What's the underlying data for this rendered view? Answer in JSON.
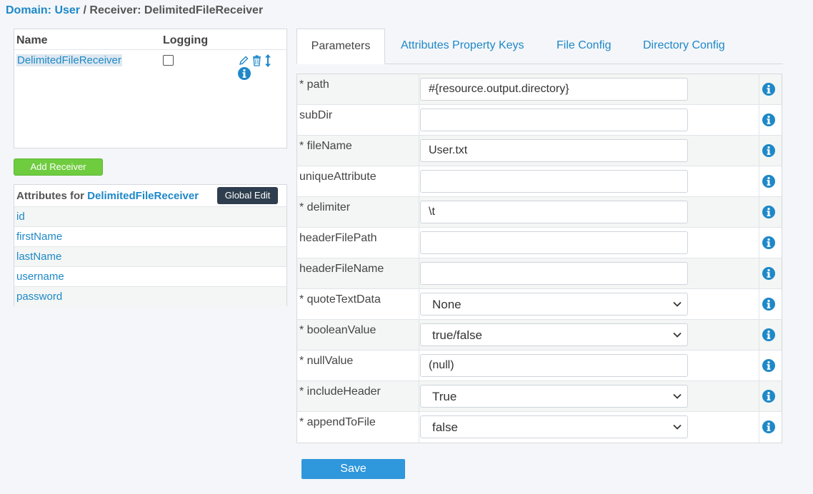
{
  "breadcrumb": {
    "domain_label": "Domain:",
    "domain_value": "User",
    "separator": "/",
    "receiver_text": "Receiver: DelimitedFileReceiver"
  },
  "receivers": {
    "col_name": "Name",
    "col_logging": "Logging",
    "rows": [
      {
        "name": "DelimitedFileReceiver",
        "logging": false
      }
    ],
    "icons": [
      "edit-icon",
      "trash-icon",
      "sort-icon",
      "info-icon"
    ]
  },
  "add_receiver_label": "Add Receiver",
  "attributes": {
    "title_prefix": "Attributes for",
    "title_name": "DelimitedFileReceiver",
    "global_edit_label": "Global Edit",
    "items": [
      "id",
      "firstName",
      "lastName",
      "username",
      "password"
    ]
  },
  "tabs": [
    {
      "label": "Parameters",
      "active": true
    },
    {
      "label": "Attributes Property Keys",
      "active": false
    },
    {
      "label": "File Config",
      "active": false
    },
    {
      "label": "Directory Config",
      "active": false
    }
  ],
  "params": [
    {
      "label": "* path",
      "type": "input",
      "value": "#{resource.output.directory}"
    },
    {
      "label": "subDir",
      "type": "input",
      "value": ""
    },
    {
      "label": "* fileName",
      "type": "input",
      "value": "User.txt"
    },
    {
      "label": "uniqueAttribute",
      "type": "input",
      "value": ""
    },
    {
      "label": "* delimiter",
      "type": "input",
      "value": "\\t"
    },
    {
      "label": "headerFilePath",
      "type": "input",
      "value": ""
    },
    {
      "label": "headerFileName",
      "type": "input",
      "value": ""
    },
    {
      "label": "* quoteTextData",
      "type": "select",
      "value": "None"
    },
    {
      "label": "* booleanValue",
      "type": "select",
      "value": "true/false"
    },
    {
      "label": "* nullValue",
      "type": "input",
      "value": "(null)"
    },
    {
      "label": "* includeHeader",
      "type": "select",
      "value": "True"
    },
    {
      "label": "* appendToFile",
      "type": "select",
      "value": "false"
    }
  ],
  "save_label": "Save",
  "colors": {
    "link": "#1e88c8",
    "add_button": "#6fcc3f",
    "global_edit_button": "#2f3e4e",
    "save_button": "#2f97dc",
    "info_icon": "#1e88c8"
  }
}
